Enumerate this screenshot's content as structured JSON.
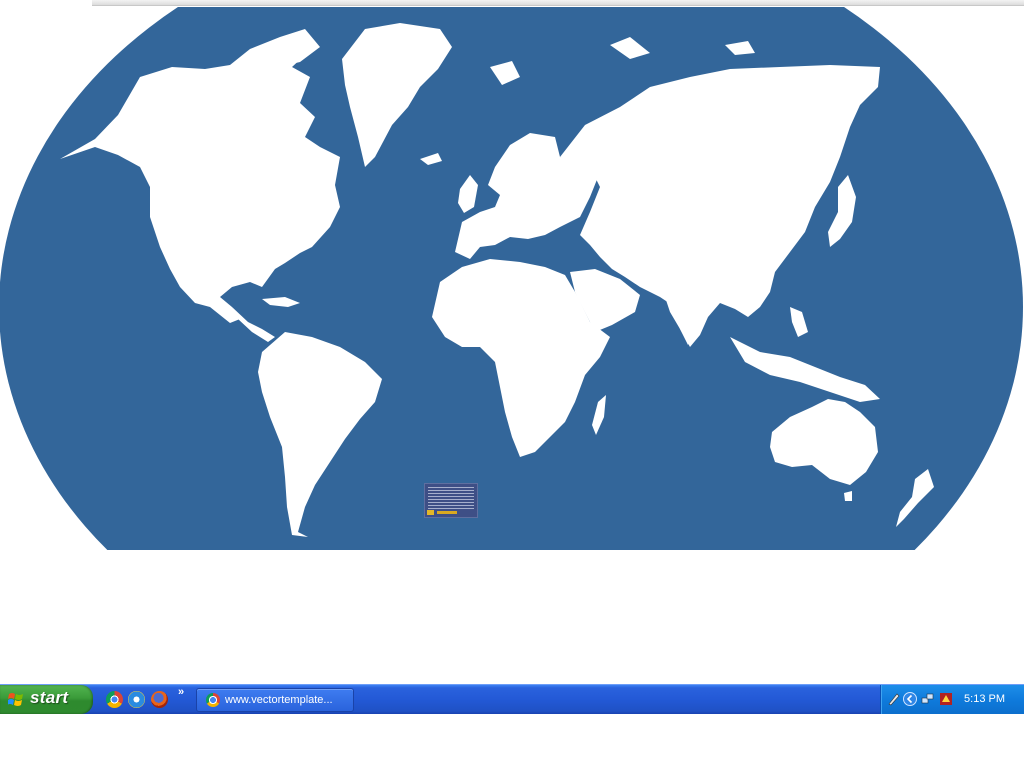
{
  "map": {
    "ocean_color": "#33669a",
    "land_color": "#ffffff"
  },
  "taskbar": {
    "start_label": "start",
    "quick_launch": [
      "chrome-icon",
      "ie-icon",
      "firefox-icon"
    ],
    "chevron": "»",
    "task_button_label": "www.vectortemplate...",
    "clock": "5:13 PM"
  }
}
